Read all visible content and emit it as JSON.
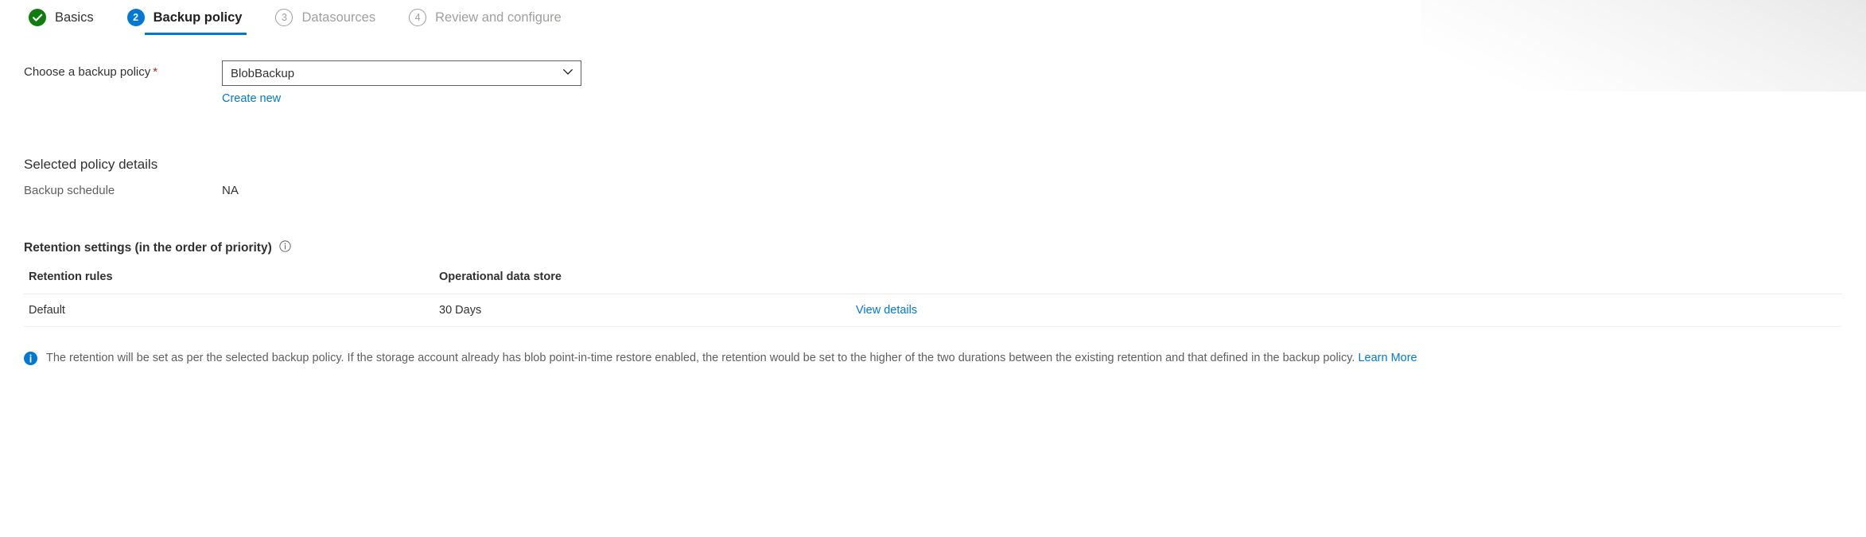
{
  "colors": {
    "accent": "#0078d4",
    "success": "#107c10",
    "required": "#a4262c",
    "muted": "#a19f9d",
    "text": "#323130"
  },
  "wizard": {
    "tabs": [
      {
        "label": "Basics",
        "marker": "check",
        "state": "done"
      },
      {
        "label": "Backup policy",
        "marker": "2",
        "state": "current"
      },
      {
        "label": "Datasources",
        "marker": "3",
        "state": "pending"
      },
      {
        "label": "Review and configure",
        "marker": "4",
        "state": "pending"
      }
    ]
  },
  "form": {
    "policy_label": "Choose a backup policy",
    "required_mark": "*",
    "policy_value": "BlobBackup",
    "create_new_label": "Create new"
  },
  "policy_details": {
    "title": "Selected policy details",
    "rows": [
      {
        "key": "Backup schedule",
        "value": "NA"
      }
    ]
  },
  "retention": {
    "title": "Retention settings (in the order of priority)",
    "columns": [
      "Retention rules",
      "Operational data store",
      ""
    ],
    "rows": [
      {
        "rule": "Default",
        "store": "30 Days",
        "action": "View details"
      }
    ]
  },
  "banner": {
    "text": "The retention will be set as per the selected backup policy. If the storage account already has blob point-in-time restore enabled, the retention would be set to the higher of the two durations between the existing retention and that defined in the backup policy.",
    "link": "Learn More"
  }
}
